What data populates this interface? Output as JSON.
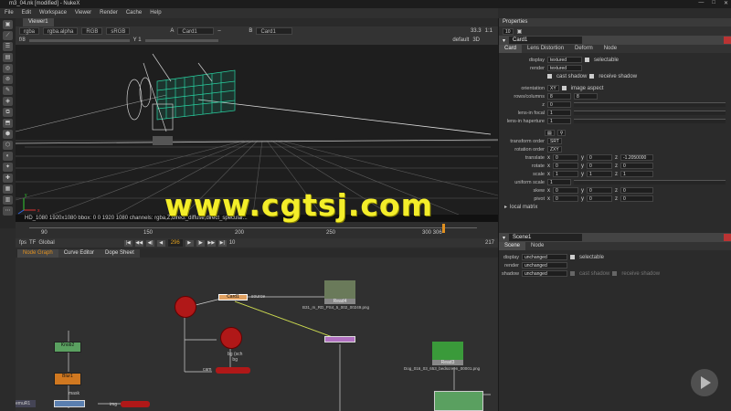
{
  "window": {
    "title": "m3_04.nk [modified] - NukeX"
  },
  "menu": [
    "File",
    "Edit",
    "Workspace",
    "Viewer",
    "Render",
    "Cache",
    "Help"
  ],
  "tools": [
    "▣",
    "⟋",
    "☰",
    "▤",
    "◎",
    "⊚",
    "✎",
    "◈",
    "⧉",
    "⬒",
    "⬢",
    "⬡",
    "◐",
    "✦",
    "✚",
    "▦",
    "▥",
    "⋯"
  ],
  "viewer": {
    "tab": "Viewer1",
    "channels": "rgba",
    "alpha": "rgba.alpha",
    "colorspace": "RGB",
    "lut": "sRGB",
    "input_a_label": "A",
    "input_a": "Card1",
    "input_b_label": "B",
    "input_b": "Card1",
    "zoom": "1:1",
    "gain": "33.3",
    "proxy": "default",
    "view": "3D",
    "info": "HD_1080 1920x1080  bbox: 0 0 1920 1080 channels: rgba,Z,direct_diffuse,direct_specular...",
    "timeline_ticks": [
      "90",
      "150",
      "200",
      "250",
      "300 306"
    ],
    "frame": "296",
    "fps_label": "fps",
    "tf_label": "TF",
    "global_label": "Global",
    "step": "10",
    "end_frame": "217"
  },
  "nodegraph": {
    "tabs": [
      "Node Graph",
      "Curve Editor",
      "Dope Sheet"
    ],
    "nodes": {
      "read4": "Read4",
      "read4_file": "B31_m_RD_PS4_5_002_00249.png",
      "read3": "Read3",
      "read3_file": "Dog_016_03_653_bedscreen_00001.png",
      "knob2": "Knob2",
      "knob2_sub": "(alpha)",
      "blur1": "Blur1",
      "blur1_sub": "(all)",
      "mask": "mask",
      "source": "source",
      "cam": "cam",
      "bg": "bg",
      "bg2": "bg (sch\nbg",
      "emuR": "emuR1",
      "merge": "Knob2\n(alpha1)",
      "img": "img",
      "card_sel": "Card1"
    }
  },
  "properties": {
    "title": "Properties",
    "max": "10",
    "card": {
      "name": "Card1",
      "tabs": [
        "Card",
        "Lens Distortion",
        "Deform",
        "Node"
      ],
      "display_label": "display",
      "display": "textured",
      "selectable": "selectable",
      "render_label": "render",
      "render": "textured",
      "cast_shadow": "cast shadow",
      "receive_shadow": "receive shadow",
      "orientation_label": "orientation",
      "orientation": "XY",
      "image_aspect": "image aspect",
      "rows_label": "rows/columns",
      "rows": "8",
      "cols": "8",
      "z_label": "z",
      "z": "0",
      "lens_label": "lens-in focal",
      "lens": "1",
      "haperture_label": "lens-in haperture",
      "haperture": "1",
      "transform_order_label": "transform order",
      "transform_order": "SRT",
      "rotation_order_label": "rotation order",
      "rotation_order": "ZXY",
      "translate_label": "translate",
      "tx": "0",
      "ty": "0",
      "tz": "-1.2050000",
      "rotate_label": "rotate",
      "rx": "0",
      "ry": "0",
      "rz": "0",
      "scale_label": "scale",
      "sx": "1",
      "sy": "1",
      "sz": "1",
      "uniform_label": "uniform scale",
      "uniform": "1",
      "skew_label": "skew",
      "kx": "0",
      "ky": "0",
      "kz": "0",
      "pivot_label": "pivot",
      "px": "0",
      "py": "0",
      "pz": "0",
      "local_matrix": "local matrix"
    },
    "scene": {
      "name": "Scene1",
      "tabs": [
        "Scene",
        "Node"
      ],
      "display_label": "display",
      "display": "unchanged",
      "selectable": "selectable",
      "render_label": "render",
      "render": "unchanged",
      "shadow_label": "shadow",
      "shadow": "unchanged",
      "cast_shadow": "cast shadow",
      "receive_shadow": "receive shadow"
    }
  },
  "watermark": "www.cgtsj.com",
  "axis": {
    "x": "x",
    "y": "y",
    "z": "z"
  }
}
